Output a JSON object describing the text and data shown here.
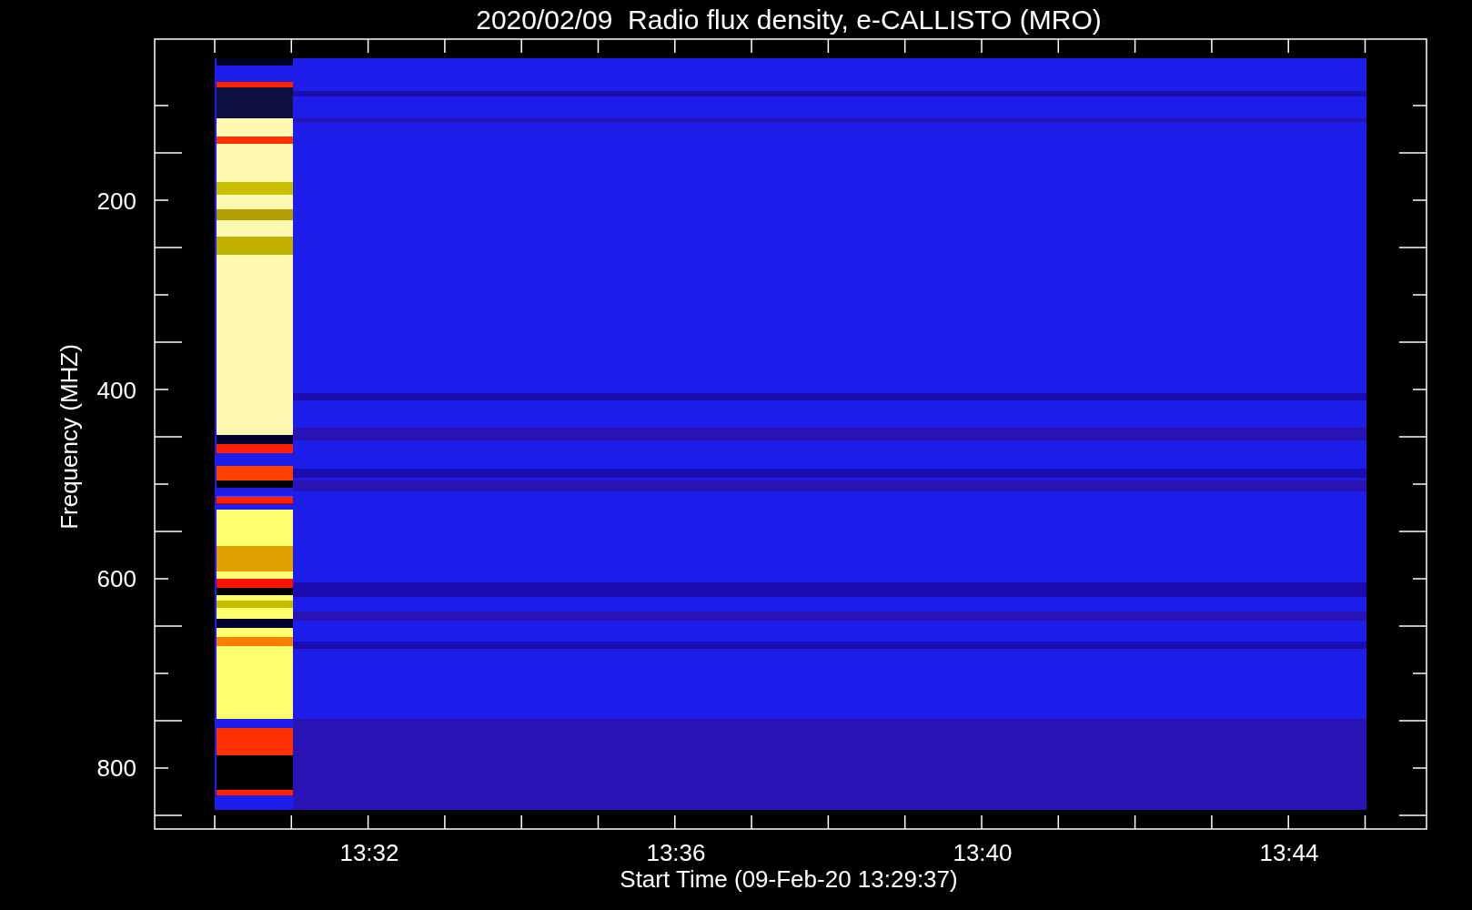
{
  "title": "2020/02/09  Radio flux density, e-CALLISTO (MRO)",
  "y_axis": {
    "label": "Frequency (MHZ)",
    "ticks": [
      "200",
      "400",
      "600",
      "800"
    ]
  },
  "x_axis": {
    "label": "Start Time (09-Feb-20 13:29:37)",
    "ticks": [
      "13:32",
      "13:36",
      "13:40",
      "13:44"
    ]
  }
}
